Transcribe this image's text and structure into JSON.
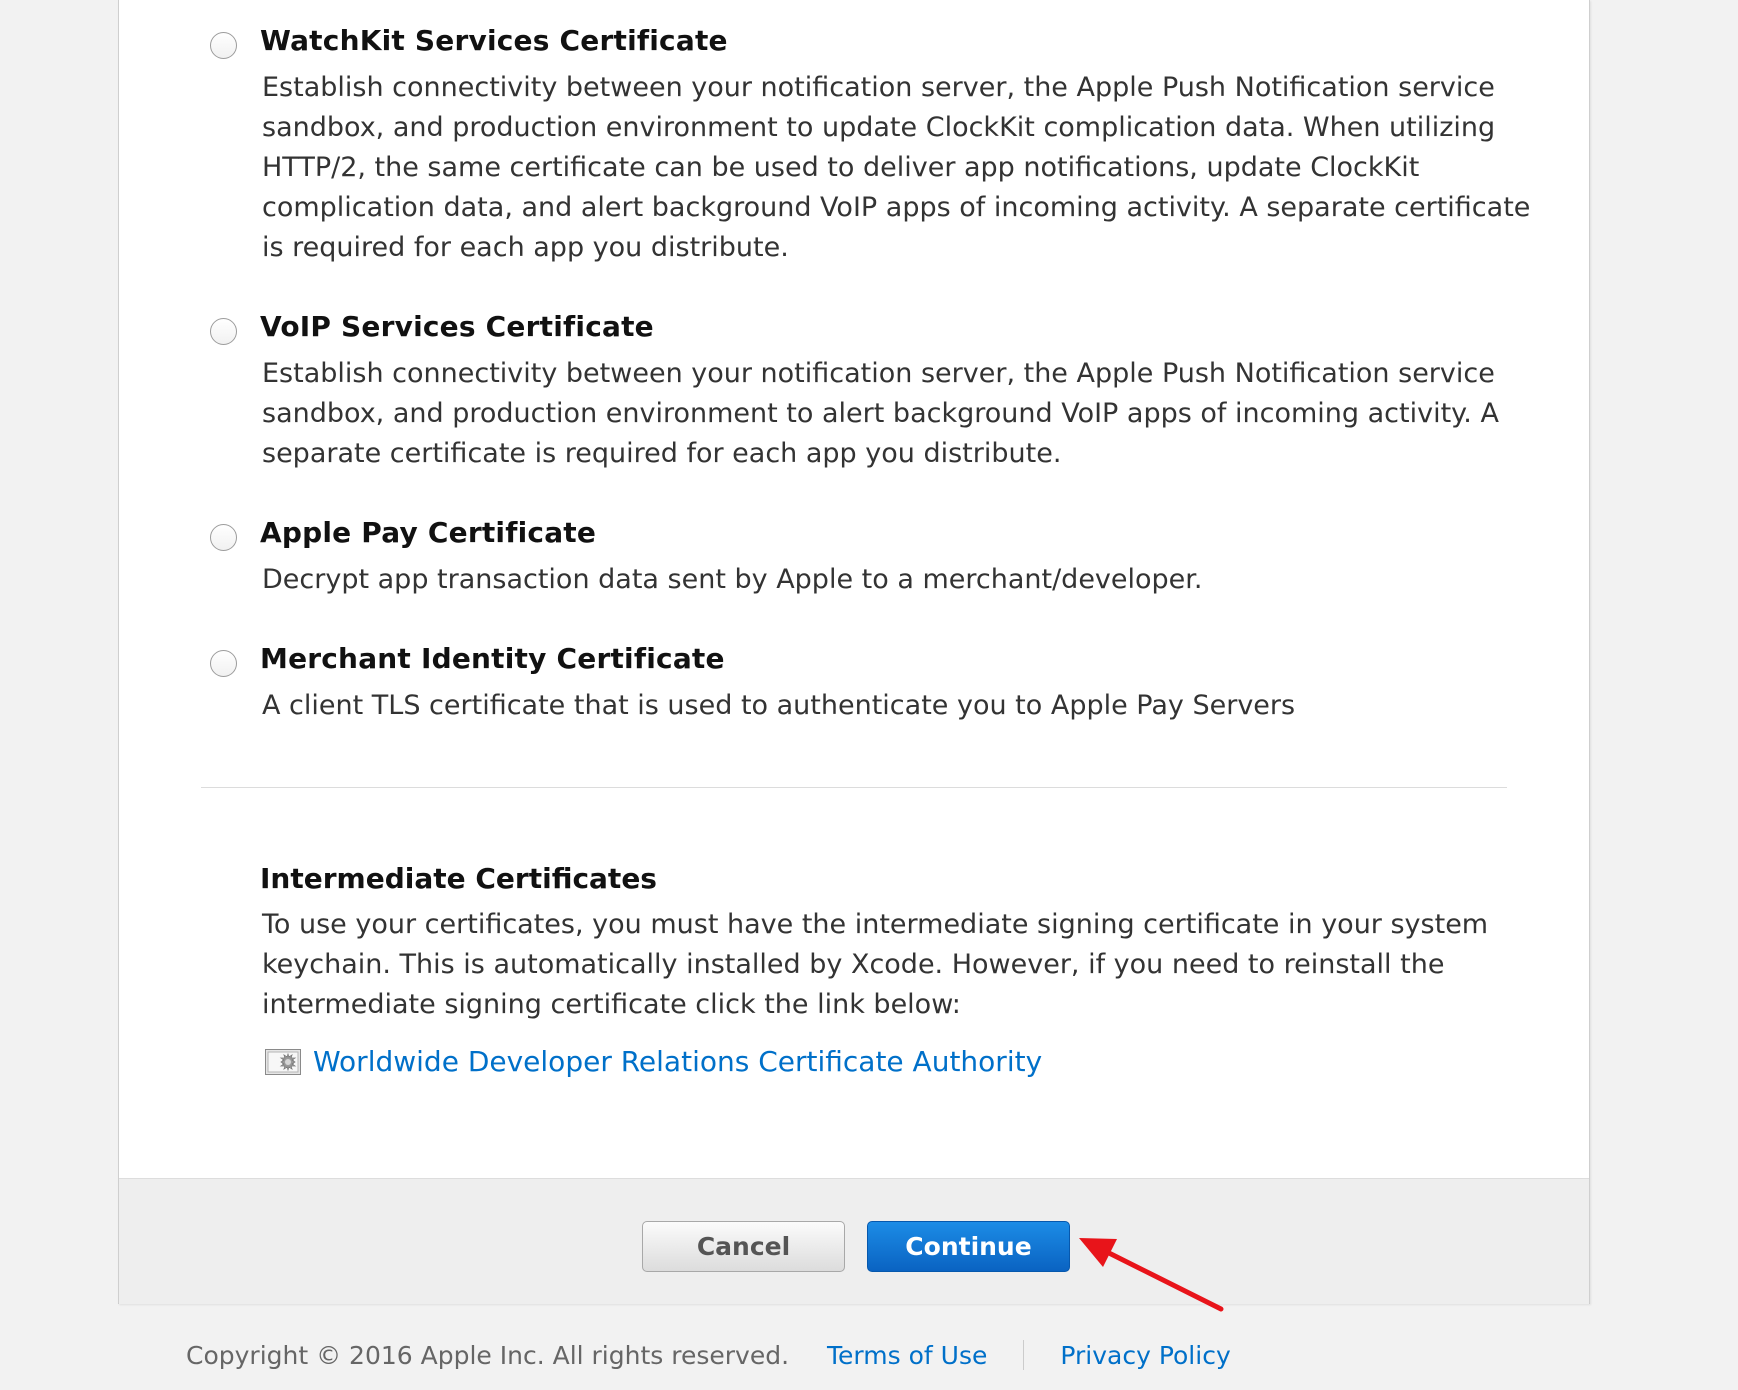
{
  "options": [
    {
      "title": "WatchKit Services Certificate",
      "lines": [
        "Establish connectivity between your notification server, the Apple Push Notification service",
        "sandbox, and production environment to update ClockKit complication data. When utilizing",
        "HTTP/2, the same certificate can be used to deliver app notifications, update ClockKit",
        "complication data, and alert background VoIP apps of incoming activity. A separate certificate",
        "is required for each app you distribute."
      ]
    },
    {
      "title": "VoIP Services Certificate",
      "lines": [
        "Establish connectivity between your notification server, the Apple Push Notification service",
        "sandbox, and production environment to alert background VoIP apps of incoming activity. A",
        "separate certificate is required for each app you distribute."
      ]
    },
    {
      "title": "Apple Pay Certificate",
      "lines": [
        "Decrypt app transaction data sent by Apple to a merchant/developer."
      ]
    },
    {
      "title": "Merchant Identity Certificate",
      "lines": [
        "A client TLS certificate that is used to authenticate you to Apple Pay Servers"
      ]
    }
  ],
  "intermediate": {
    "title": "Intermediate Certificates",
    "lines": [
      "To use your certificates, you must have the intermediate signing certificate in your system",
      "keychain. This is automatically installed by Xcode. However, if you need to reinstall the",
      "intermediate signing certificate click the link below:"
    ],
    "link_label": "Worldwide Developer Relations Certificate Authority",
    "link_icon": "certificate-icon"
  },
  "actions": {
    "cancel_label": "Cancel",
    "continue_label": "Continue"
  },
  "footer": {
    "copyright": "Copyright © 2016 Apple Inc. All rights reserved.",
    "terms_label": "Terms of Use",
    "privacy_label": "Privacy Policy"
  },
  "colors": {
    "link": "#0070c9",
    "primary_button": "#0a63c2",
    "annotation_arrow": "#e8141a"
  }
}
